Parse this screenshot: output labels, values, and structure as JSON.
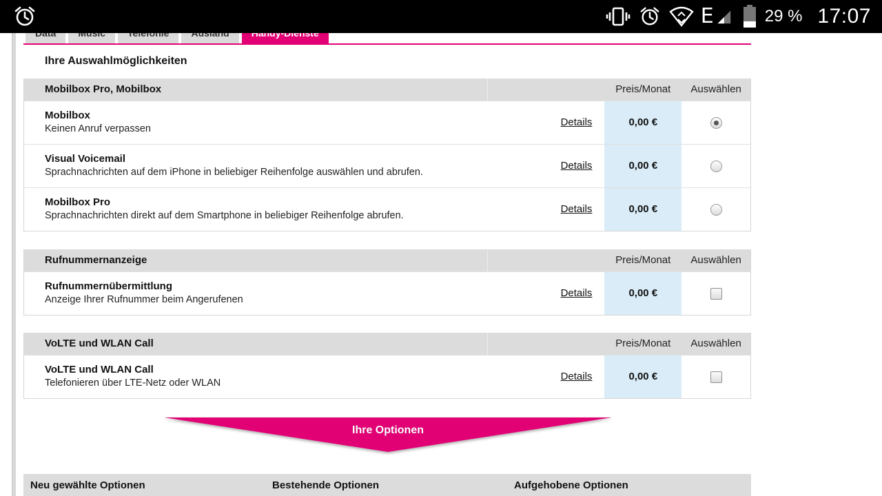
{
  "status_bar": {
    "alarm_icon": "alarm-clock-icon",
    "battery_percent": "29 %",
    "network_type": "E",
    "time": "17:07"
  },
  "tabs": [
    {
      "label": "Data",
      "active": false
    },
    {
      "label": "Music",
      "active": false
    },
    {
      "label": "Telefonie",
      "active": false
    },
    {
      "label": "Ausland",
      "active": false
    },
    {
      "label": "Handy-Dienste",
      "active": true
    }
  ],
  "heading": "Ihre Auswahlmöglichkeiten",
  "sections": [
    {
      "title": "Mobilbox Pro, Mobilbox",
      "price_header": "Preis/Monat",
      "select_header": "Auswählen",
      "rows": [
        {
          "name": "Mobilbox",
          "sub": "Keinen Anruf verpassen",
          "details": "Details",
          "price": "0,00 €",
          "control": "radio",
          "checked": true
        },
        {
          "name": "Visual Voicemail",
          "sub": "Sprachnachrichten auf dem iPhone in beliebiger Reihenfolge auswählen und abrufen.",
          "details": "Details",
          "price": "0,00 €",
          "control": "radio",
          "checked": false
        },
        {
          "name": "Mobilbox Pro",
          "sub": "Sprachnachrichten direkt auf dem Smartphone in beliebiger Reihenfolge abrufen.",
          "details": "Details",
          "price": "0,00 €",
          "control": "radio",
          "checked": false
        }
      ]
    },
    {
      "title": "Rufnummernanzeige",
      "price_header": "Preis/Monat",
      "select_header": "Auswählen",
      "rows": [
        {
          "name": "Rufnummernübermittlung",
          "sub": "Anzeige Ihrer Rufnummer beim Angerufenen",
          "details": "Details",
          "price": "0,00 €",
          "control": "checkbox",
          "checked": false
        }
      ]
    },
    {
      "title": "VoLTE und WLAN Call",
      "price_header": "Preis/Monat",
      "select_header": "Auswählen",
      "rows": [
        {
          "name": "VoLTE und WLAN Call",
          "sub": "Telefonieren über LTE-Netz oder WLAN",
          "details": "Details",
          "price": "0,00 €",
          "control": "checkbox",
          "checked": false
        }
      ]
    }
  ],
  "banner": {
    "label": "Ihre Optionen",
    "color": "#e20074"
  },
  "options_table": {
    "headers": [
      "Neu gewählte Optionen",
      "Bestehende Optionen",
      "Aufgehobene Optionen"
    ]
  },
  "colors": {
    "accent": "#e20074",
    "price_bg": "#d9ecf7",
    "header_bg": "#dcdcdc"
  }
}
